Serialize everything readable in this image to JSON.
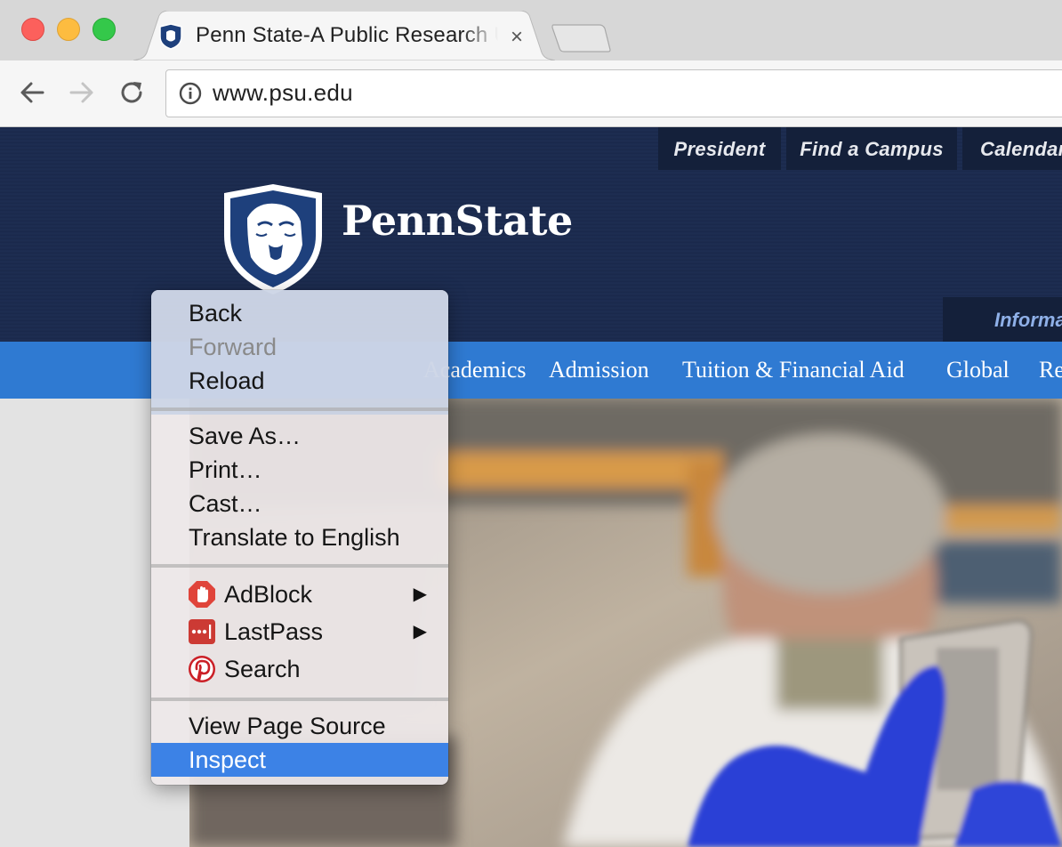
{
  "browser": {
    "tab_title": "Penn State-A Public Research University",
    "tab_close": "×",
    "url": "www.psu.edu"
  },
  "site": {
    "top_links": [
      "President",
      "Find a Campus",
      "Calendar"
    ],
    "wordmark": "PennState",
    "info_tab": "Information for",
    "nav": [
      "Academics",
      "Admission",
      "Tuition & Financial Aid",
      "Global",
      "Research"
    ]
  },
  "context_menu": {
    "group1": {
      "back": "Back",
      "forward": "Forward",
      "reload": "Reload"
    },
    "group2": {
      "save_as": "Save As…",
      "print": "Print…",
      "cast": "Cast…",
      "translate": "Translate to English"
    },
    "group3": {
      "adblock": "AdBlock",
      "lastpass": "LastPass",
      "search": "Search",
      "submenu_arrow": "▶"
    },
    "group4": {
      "view_source": "View Page Source",
      "inspect": "Inspect"
    },
    "selected_item": "Inspect",
    "disabled_item": "Forward"
  },
  "colors": {
    "header_navy": "#1b2a4c",
    "nav_blue": "#2f7ad2",
    "menu_highlight": "#3c82e6"
  }
}
